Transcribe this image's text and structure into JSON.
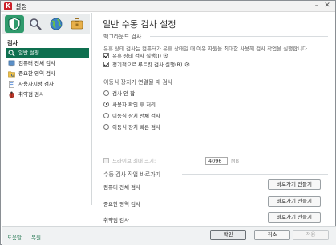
{
  "window": {
    "title": "설정",
    "logo": "K",
    "minimize": "–",
    "close": "✕"
  },
  "toolbar": {
    "buttons": [
      {
        "icon": "shield-icon",
        "active": true
      },
      {
        "icon": "search-icon",
        "active": false
      },
      {
        "icon": "globe-icon",
        "active": false
      },
      {
        "icon": "briefcase-icon",
        "active": false
      }
    ]
  },
  "sidebar": {
    "section": "검사",
    "items": [
      {
        "label": "일반 설정",
        "icon": "search-icon"
      },
      {
        "label": "컴퓨터 전체 검사",
        "icon": "computer-icon"
      },
      {
        "label": "중요한 영역 검사",
        "icon": "folder-icon"
      },
      {
        "label": "사용자지정 검사",
        "icon": "document-icon"
      },
      {
        "label": "취약점 검사",
        "icon": "bug-icon"
      }
    ]
  },
  "main": {
    "title": "일반 수동 검사 설정",
    "background": {
      "heading": "백그라운드 검사",
      "description": "유휴 상태 검사는 컴퓨터가 유휴 상태일 때 여유 자원을 최대한 사용해 검사 작업을 실행합니다.",
      "options": [
        {
          "label": "유휴 상태 검사 실행(I)",
          "checked": true
        },
        {
          "label": "정기적으로 루트킷 검사 실행(R)",
          "checked": true
        }
      ]
    },
    "removable": {
      "heading": "이동식 장치가 연결될 때 검사",
      "options": [
        {
          "label": "검사 안 함",
          "selected": false
        },
        {
          "label": "사용자 확인 후 처리",
          "selected": true
        },
        {
          "label": "이동식 장치 전체 검사",
          "selected": false
        },
        {
          "label": "이동식 장치 빠른 검사",
          "selected": false
        }
      ],
      "max_drive": {
        "label": "드라이브 최대 크기:",
        "value": "4096",
        "unit": "MB",
        "checked": false
      }
    },
    "shortcuts": {
      "heading": "수동 검사 작업 바로가기",
      "items": [
        {
          "label": "컴퓨터 전체 검사",
          "button": "바로가기 만들기"
        },
        {
          "label": "중요한 영역 검사",
          "button": "바로가기 만들기"
        },
        {
          "label": "취약점 검사",
          "button": "바로가기 만들기"
        }
      ]
    }
  },
  "footer": {
    "help": "도움말",
    "restore": "복원",
    "ok": "확인",
    "cancel": "취소",
    "apply": "적용"
  }
}
